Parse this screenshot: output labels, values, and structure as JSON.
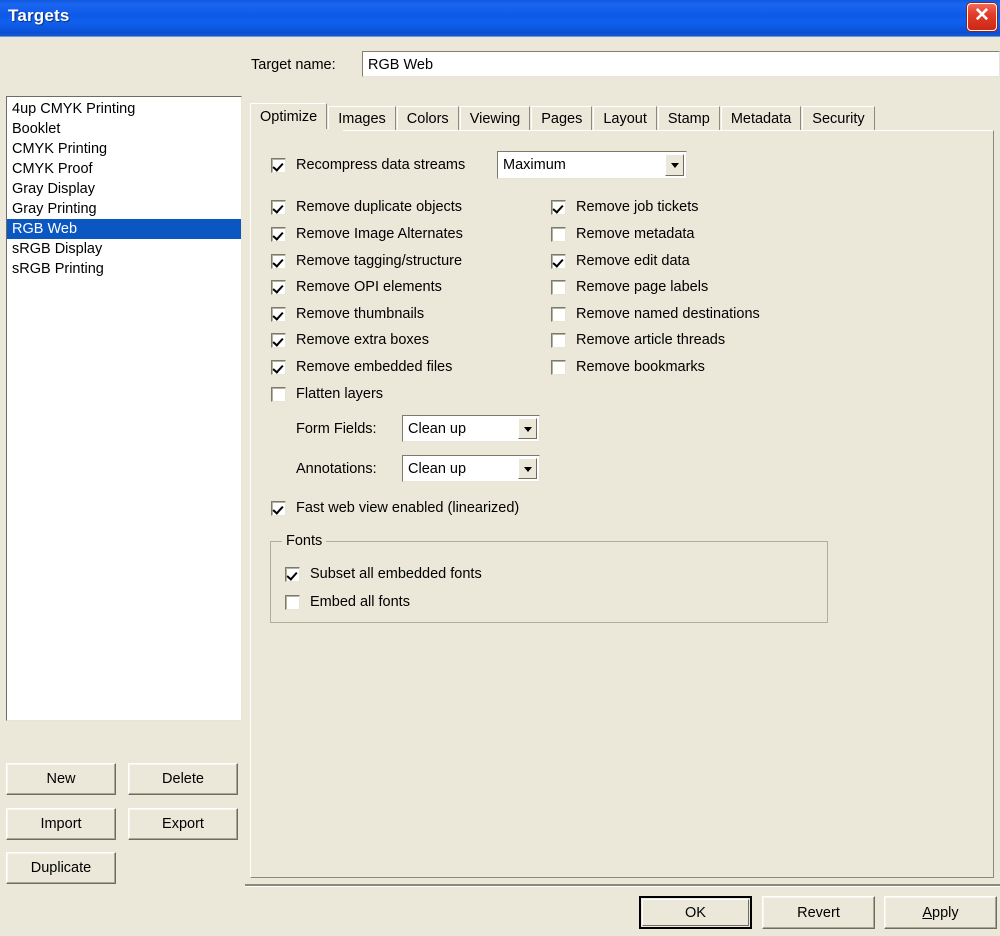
{
  "window": {
    "title": "Targets",
    "close_icon": "close-icon",
    "close_glyph": "✕"
  },
  "target_name": {
    "label": "Target name:",
    "value": "RGB Web",
    "placeholder": ""
  },
  "target_list": {
    "items": [
      {
        "label": "4up CMYK Printing",
        "selected": false
      },
      {
        "label": "Booklet",
        "selected": false
      },
      {
        "label": "CMYK Printing",
        "selected": false
      },
      {
        "label": "CMYK Proof",
        "selected": false
      },
      {
        "label": "Gray Display",
        "selected": false
      },
      {
        "label": "Gray Printing",
        "selected": false
      },
      {
        "label": "RGB Web",
        "selected": true
      },
      {
        "label": "sRGB Display",
        "selected": false
      },
      {
        "label": "sRGB Printing",
        "selected": false
      }
    ]
  },
  "list_buttons": {
    "new": "New",
    "delete": "Delete",
    "import": "Import",
    "export": "Export",
    "duplicate": "Duplicate"
  },
  "tabs": [
    {
      "label": "Optimize",
      "active": true
    },
    {
      "label": "Images",
      "active": false
    },
    {
      "label": "Colors",
      "active": false
    },
    {
      "label": "Viewing",
      "active": false
    },
    {
      "label": "Pages",
      "active": false
    },
    {
      "label": "Layout",
      "active": false
    },
    {
      "label": "Stamp",
      "active": false
    },
    {
      "label": "Metadata",
      "active": false
    },
    {
      "label": "Security",
      "active": false
    }
  ],
  "optimize": {
    "recompress": {
      "label": "Recompress data streams",
      "checked": true,
      "combo_value": "Maximum"
    },
    "left_column": [
      {
        "label": "Remove duplicate objects",
        "checked": true
      },
      {
        "label": "Remove Image Alternates",
        "checked": true
      },
      {
        "label": "Remove tagging/structure",
        "checked": true
      },
      {
        "label": "Remove OPI elements",
        "checked": true
      },
      {
        "label": "Remove thumbnails",
        "checked": true
      },
      {
        "label": "Remove extra boxes",
        "checked": true
      },
      {
        "label": "Remove embedded files",
        "checked": true
      },
      {
        "label": "Flatten layers",
        "checked": false
      }
    ],
    "right_column": [
      {
        "label": "Remove job tickets",
        "checked": true
      },
      {
        "label": "Remove metadata",
        "checked": false
      },
      {
        "label": "Remove edit data",
        "checked": true
      },
      {
        "label": "Remove page labels",
        "checked": false
      },
      {
        "label": "Remove named destinations",
        "checked": false
      },
      {
        "label": "Remove article threads",
        "checked": false
      },
      {
        "label": "Remove bookmarks",
        "checked": false
      }
    ],
    "form_fields": {
      "label": "Form Fields:",
      "value": "Clean up"
    },
    "annotations": {
      "label": "Annotations:",
      "value": "Clean up"
    },
    "fast_web_view": {
      "label": "Fast web view enabled (linearized)",
      "checked": true
    },
    "fonts_group": {
      "title": "Fonts",
      "items": [
        {
          "label": "Subset all embedded fonts",
          "checked": true
        },
        {
          "label": "Embed all fonts",
          "checked": false
        }
      ]
    }
  },
  "dialog_buttons": {
    "ok": "OK",
    "revert": "Revert",
    "apply_prefix": "A",
    "apply_rest": "pply"
  },
  "colors": {
    "dialog_face": "#ebe7d9",
    "titlebar_blue": "#0e5ae8",
    "selection_blue": "#0a57c2",
    "close_red": "#e33b27",
    "text": "#000000"
  }
}
